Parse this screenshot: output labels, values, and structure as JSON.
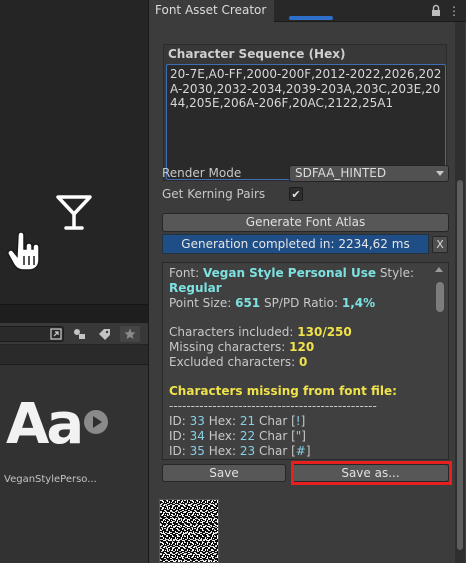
{
  "window": {
    "title": "Font Asset Creator"
  },
  "asset": {
    "name": "VeganStylePerso...",
    "thumb_text": "Aa"
  },
  "character_sequence": {
    "label": "Character Sequence (Hex)",
    "value": "20-7E,A0-FF,2000-200F,2012-2022,2026,202A-2030,2032-2034,2039-203A,203C,203E,2044,205E,206A-206F,20AC,2122,25A1"
  },
  "render_mode": {
    "label": "Render Mode",
    "value": "SDFAA_HINTED"
  },
  "kerning": {
    "label": "Get Kerning Pairs",
    "checked": true,
    "check_glyph": "✔"
  },
  "buttons": {
    "generate": "Generate Font Atlas",
    "save": "Save",
    "save_as": "Save as...",
    "clear": "X"
  },
  "progress": {
    "text": "Generation completed in: 2234,62 ms",
    "fraction": 1.0
  },
  "report": {
    "font_label": "Font: ",
    "font_name": "Vegan Style Personal Use",
    "style_label": "  Style: ",
    "style_value": "Regular",
    "point_size_label": "Point Size: ",
    "point_size": "651",
    "sp_pd_label": "  SP/PD Ratio: ",
    "sp_pd": "1,4%",
    "chars_included_label": "Characters included: ",
    "chars_included": "130/250",
    "missing_label": "Missing characters: ",
    "missing": "120",
    "excluded_label": "Excluded characters: ",
    "excluded": "0",
    "missing_heading": "Characters missing from font file:",
    "separator": "------------------------------------------------",
    "rows": [
      {
        "id_label": "ID: ",
        "id": "33",
        "hex_label": "   Hex: ",
        "hex": "21",
        "char_label": "  Char [",
        "char": "!",
        "close": "]"
      },
      {
        "id_label": "ID: ",
        "id": "34",
        "hex_label": "   Hex: ",
        "hex": "22",
        "char_label": "  Char [",
        "char": "\"",
        "close": "]"
      },
      {
        "id_label": "ID: ",
        "id": "35",
        "hex_label": "   Hex: ",
        "hex": "23",
        "char_label": "  Char [",
        "char": "#",
        "close": "]"
      }
    ]
  },
  "colors": {
    "highlight": "#e5201f",
    "progress": "#1f4e86",
    "cyan": "#7ee1e1",
    "yellow": "#f0e24a"
  },
  "icons": [
    "cocktail-icon",
    "hand-pointer-icon",
    "tag-icon",
    "star-icon",
    "lock-icon",
    "more-icon",
    "play-icon"
  ]
}
